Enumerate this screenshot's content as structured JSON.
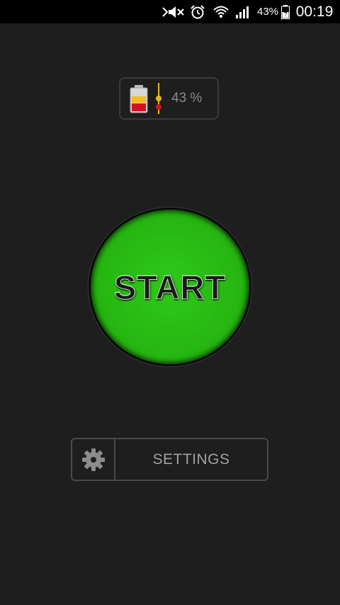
{
  "status_bar": {
    "icons": [
      "mute-icon",
      "alarm-icon",
      "wifi-icon",
      "signal-icon",
      "battery-icon"
    ],
    "battery_percent": "43%",
    "clock": "00:19"
  },
  "battery_widget": {
    "icon": "battery-level-icon",
    "percent_text": "43 %",
    "level": 0.43,
    "colors": {
      "top_band": "#f0c020",
      "bottom_band": "#d81020",
      "marker_yellow": "#e8b820",
      "marker_red": "#d01818"
    }
  },
  "start_button": {
    "label": "START",
    "color": "#25b410"
  },
  "settings_button": {
    "icon": "gear-icon",
    "label": "SETTINGS"
  },
  "colors": {
    "background": "#1e1e1e",
    "status_bar": "#000000",
    "border": "#4a4a4a"
  }
}
